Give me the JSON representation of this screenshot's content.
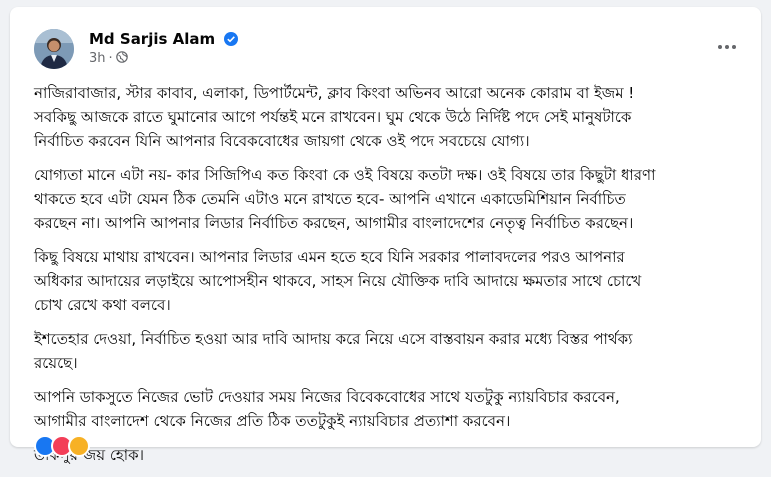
{
  "post": {
    "author": "Md Sarjis Alam",
    "time": "3h",
    "icons": {
      "verified": "verified-badge-icon",
      "audience": "globe-icon",
      "more": "more-options-icon"
    },
    "colors": {
      "verified": "#1877f2",
      "meta": "#65676b"
    },
    "paragraphs": [
      [
        "নাজিরাবাজার, স্টার কাবাব, এলাকা, ডিপার্টমেন্ট, ক্লাব কিংবা অভিনব আরো অনেক কোরাম বা ইজম !",
        "সবকিছু আজকে রাতে ঘুমানোর আগে পর্যন্তই মনে রাখবেন। ঘুম থেকে উঠে নির্দিষ্ট পদে সেই মানুষটাকে",
        "নির্বাচিত করবেন যিনি আপনার বিবেকবোধের জায়গা থেকে ওই পদে সবচেয়ে যোগ্য।"
      ],
      [
        "যোগ্যতা মানে এটা নয়- কার সিজিপিএ কত কিংবা কে ওই বিষয়ে কতটা দক্ষ। ওই বিষয়ে তার কিছুটা ধারণা",
        "থাকতে হবে এটা যেমন ঠিক তেমনি এটাও মনে রাখতে হবে- আপনি এখানে একাডেমিশিয়ান নির্বাচিত",
        "করছেন না। আপনি আপনার লিডার নির্বাচিত করছেন, আগামীর বাংলাদেশের নেতৃত্ব নির্বাচিত করছেন।"
      ],
      [
        "কিছু বিষয়ে মাথায় রাখবেন। আপনার লিডার এমন হতে হবে যিনি সরকার পালাবদলের পরও আপনার",
        "অধিকার আদায়ের লড়াইয়ে আপোসহীন থাকবে, সাহস নিয়ে যৌক্তিক দাবি আদায়ে ক্ষমতার সাথে চোখে",
        "চোখ রেখে কথা বলবে।"
      ],
      [
        "ইশতেহার দেওয়া, নির্বাচিত হওয়া আর দাবি আদায় করে নিয়ে এসে বাস্তবায়ন করার মধ্যে বিস্তর পার্থক্য",
        "রয়েছে।"
      ],
      [
        "আপনি ডাকসুতে নিজের ভোট দেওয়ার সময় নিজের বিবেকবোধের সাথে যতটুকু ন্যায়বিচার করবেন,",
        "আগামীর বাংলাদেশ থেকে নিজের প্রতি ঠিক ততটুকুই ন্যায়বিচার প্রত্যাশা করবেন।"
      ],
      [
        "ডাকসুর জয় হোক।"
      ]
    ]
  }
}
